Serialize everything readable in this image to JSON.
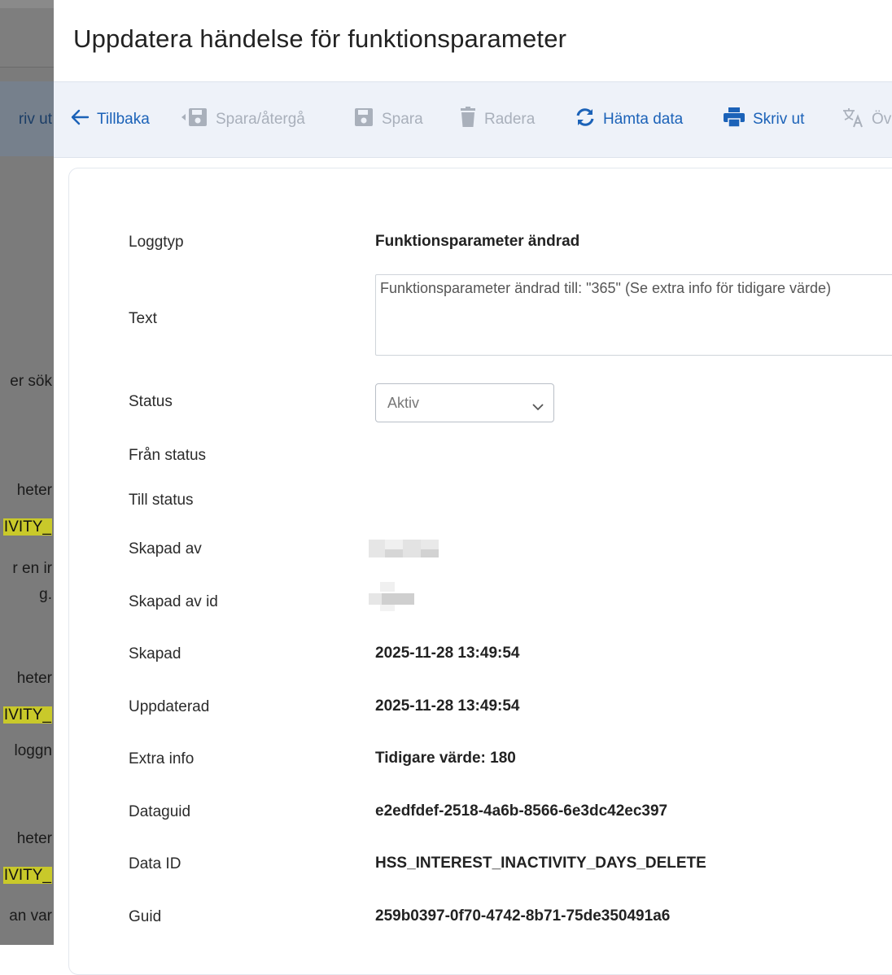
{
  "background": {
    "toolbar_fragment": "riv ut",
    "fragments": [
      "er sök",
      "heter",
      "IVITY_",
      "r en ir",
      "g.",
      "heter",
      "IVITY_",
      "loggn",
      "heter",
      "IVITY_",
      "an var"
    ]
  },
  "modal": {
    "title": "Uppdatera händelse för funktionsparameter",
    "toolbar": {
      "back": "Tillbaka",
      "save_return": "Spara/återgå",
      "save": "Spara",
      "delete": "Radera",
      "fetch": "Hämta data",
      "print": "Skriv ut",
      "translate": "Öv"
    },
    "fields": {
      "log_type_label": "Loggtyp",
      "log_type_value": "Funktionsparameter ändrad",
      "text_label": "Text",
      "text_value": "Funktionsparameter ändrad till: \"365\" (Se extra info för tidigare värde)",
      "status_label": "Status",
      "status_value": "Aktiv",
      "from_status_label": "Från status",
      "to_status_label": "Till status",
      "created_by_label": "Skapad av",
      "created_by_id_label": "Skapad av id",
      "created_label": "Skapad",
      "created_value": "2025-11-28 13:49:54",
      "updated_label": "Uppdaterad",
      "updated_value": "2025-11-28 13:49:54",
      "extra_info_label": "Extra info",
      "extra_info_value": "Tidigare värde: 180",
      "dataguid_label": "Dataguid",
      "dataguid_value": "e2edfdef-2518-4a6b-8566-6e3dc42ec397",
      "data_id_label": "Data ID",
      "data_id_value": "HSS_INTEREST_INACTIVITY_DAYS_DELETE",
      "guid_label": "Guid",
      "guid_value": "259b0397-0f70-4742-8b71-75de350491a6"
    }
  },
  "colors": {
    "accent": "#1b62b8",
    "disabled": "#a9b0bb",
    "toolbar_bg": "#eef2f9",
    "highlight": "#c9c92a"
  },
  "icons": [
    "arrow-left-icon",
    "save-return-icon",
    "save-icon",
    "trash-icon",
    "refresh-icon",
    "printer-icon",
    "translate-icon",
    "chevron-down-icon"
  ]
}
